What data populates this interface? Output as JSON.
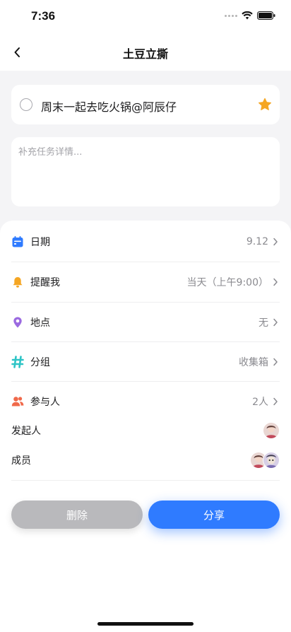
{
  "status_bar": {
    "time": "7:36"
  },
  "nav": {
    "title": "土豆立撕",
    "back_icon": "chevron-left-icon"
  },
  "task": {
    "title": "周末一起去吃火锅@阿辰仔",
    "starred": true,
    "star_color": "#f5a623"
  },
  "detail": {
    "placeholder": "补充任务详情..."
  },
  "rows": {
    "date": {
      "label": "日期",
      "value": "9.12",
      "icon": "calendar-icon",
      "icon_color": "#2f7bff"
    },
    "reminder": {
      "label": "提醒我",
      "value": "当天（上午9:00）",
      "icon": "bell-icon",
      "icon_color": "#f5a623"
    },
    "location": {
      "label": "地点",
      "value": "无",
      "icon": "location-pin-icon",
      "icon_color": "#9b6ae0"
    },
    "group": {
      "label": "分组",
      "value": "收集箱",
      "icon": "hashtag-icon",
      "icon_color": "#2ec4c6"
    },
    "participants": {
      "label": "参与人",
      "value": "2人",
      "icon": "people-icon",
      "icon_color": "#f0694a"
    }
  },
  "people": {
    "initiator_label": "发起人",
    "members_label": "成员"
  },
  "actions": {
    "delete_label": "删除",
    "share_label": "分享"
  },
  "colors": {
    "accent": "#2f7bff",
    "disabled": "#b9b9bc",
    "background": "#f4f4f6"
  }
}
